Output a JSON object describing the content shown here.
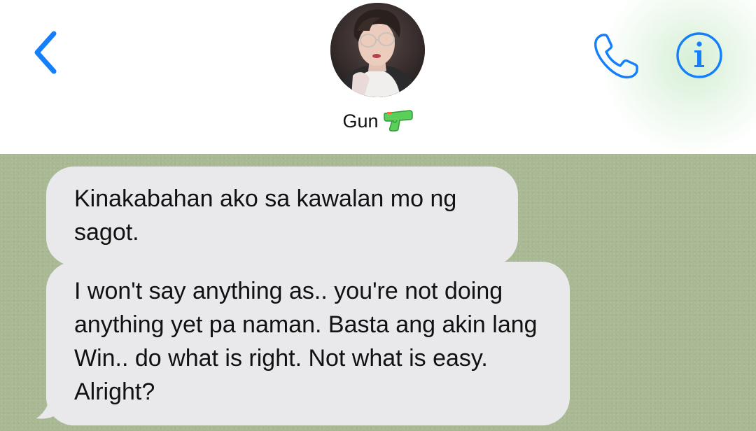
{
  "header": {
    "contact_name": "Gun",
    "contact_emoji": "water-pistol-emoji",
    "back_icon": "chevron-left-icon",
    "call_icon": "phone-icon",
    "info_icon": "info-icon",
    "accent_color": "#147efb"
  },
  "messages": [
    {
      "direction": "incoming",
      "text": "Kinakabahan ako sa kawalan mo ng sagot."
    },
    {
      "direction": "incoming",
      "text": "I won't say anything as.. you're not doing anything yet pa naman. Basta ang akin lang Win.. do what is right. Not what is easy. Alright?"
    }
  ],
  "colors": {
    "header_background": "#ffffff",
    "chat_background": "#a9b994",
    "incoming_bubble": "#e9e9eb"
  }
}
